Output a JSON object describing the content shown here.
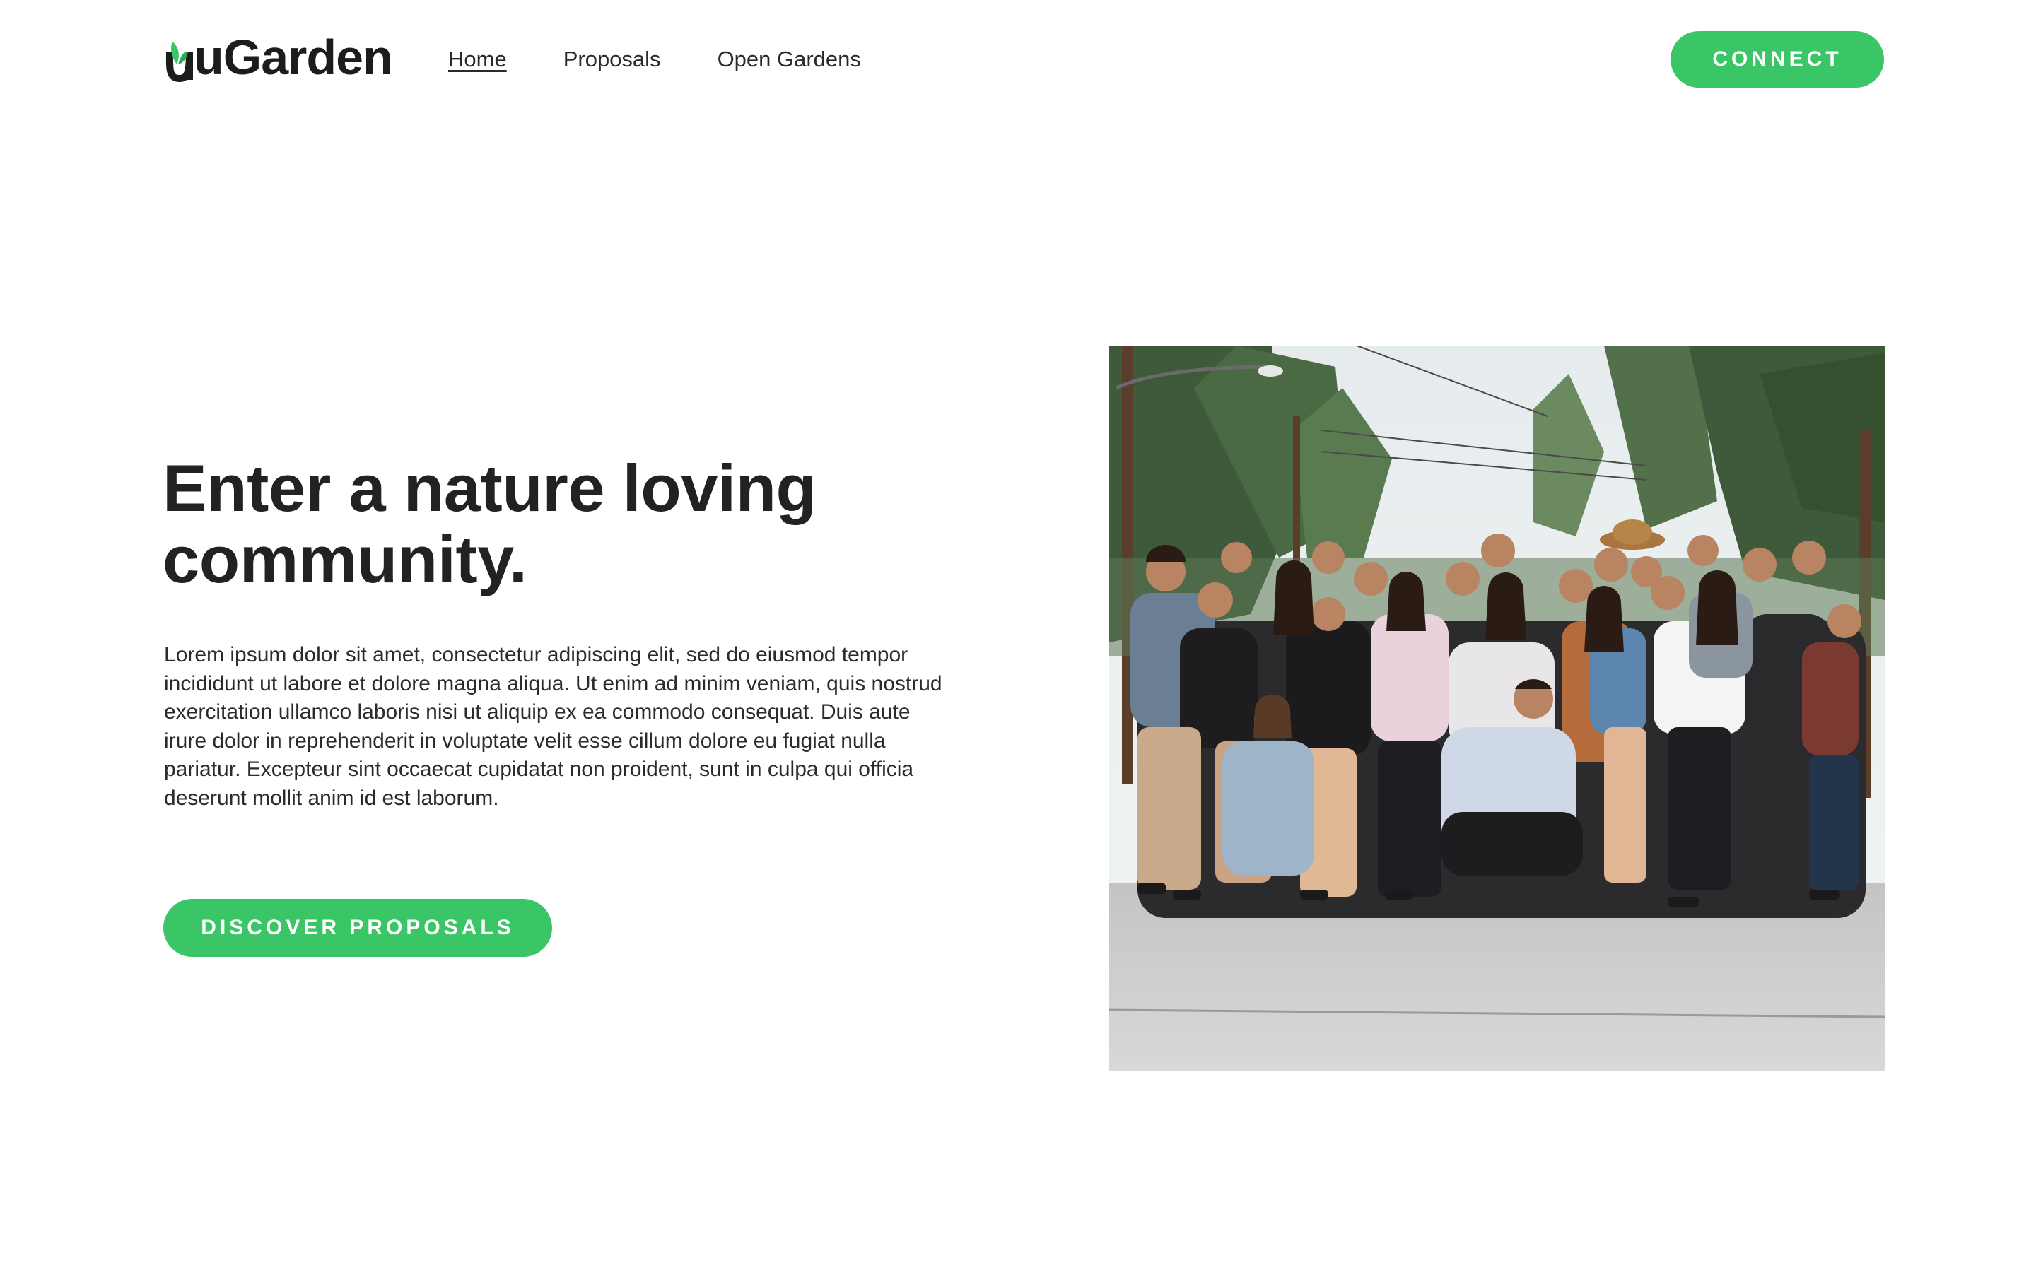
{
  "header": {
    "logo_text": "uGarden",
    "nav": [
      {
        "label": "Home",
        "active": true
      },
      {
        "label": "Proposals",
        "active": false
      },
      {
        "label": "Open Gardens",
        "active": false
      }
    ],
    "connect_label": "CONNECT"
  },
  "hero": {
    "title": "Enter a nature loving community.",
    "body": "Lorem ipsum dolor sit amet, consectetur adipiscing elit, sed do eiusmod tempor incididunt ut labore et dolore magna aliqua. Ut enim ad minim veniam, quis nostrud exercitation ullamco laboris nisi ut aliquip ex ea commodo consequat. Duis aute irure dolor in reprehenderit in voluptate velit esse cillum dolore eu fugiat nulla pariatur. Excepteur sint occaecat cupidatat non proident, sunt in culpa qui officia deserunt mollit anim id est laborum.",
    "cta_label": "DISCOVER PROPOSALS"
  },
  "icons": {
    "logo_mark": "sprout-icon"
  },
  "colors": {
    "accent": "#3ac567",
    "text": "#222222",
    "background": "#ffffff"
  }
}
